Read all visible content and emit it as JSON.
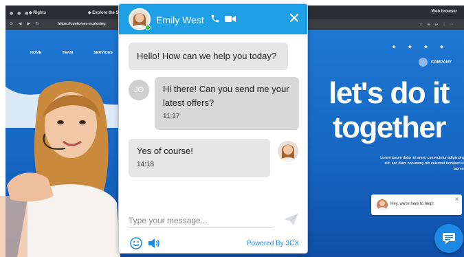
{
  "browser": {
    "tabs": [
      "Rights",
      "Explore the Site"
    ],
    "tab_right": "Web browser",
    "url": "https://customer-exploring",
    "nav_glyphs": "⊙ ◀ ▶ ↻",
    "addr_icons": "☆ ⊕ ⊖ ⋮ ⋯"
  },
  "site": {
    "nav": [
      "HOME",
      "TEAM",
      "SERVICES"
    ],
    "company": "COMPANY",
    "hero_line_1": "let's do it",
    "hero_line_2": "together",
    "hero_sub": "Lorem ipsum dolor sit amet, consectetur adipiscing elit, sed diam nonummy nih euismod tincidunt ut laoreet",
    "top_icons": "⬥ ⬥ ⬥ ⬥"
  },
  "chat": {
    "agent_name": "Emily West",
    "messages": [
      {
        "from": "agent",
        "text": "Hello! How can we help you today?"
      },
      {
        "from": "visitor",
        "initials": "JO",
        "text": "Hi there! Can you send me your latest offers?",
        "time": "11:17"
      },
      {
        "from": "agent",
        "text": "Yes of course!",
        "time": "14:18"
      }
    ],
    "composer_placeholder": "Type your message...",
    "powered_by": "Powered By 3CX",
    "colors": {
      "header": "#1e9fe6",
      "accent": "#1e88e5",
      "online": "#27c93f"
    }
  },
  "help_popup": {
    "text": "Hey, we're here to help!",
    "close": "×"
  }
}
